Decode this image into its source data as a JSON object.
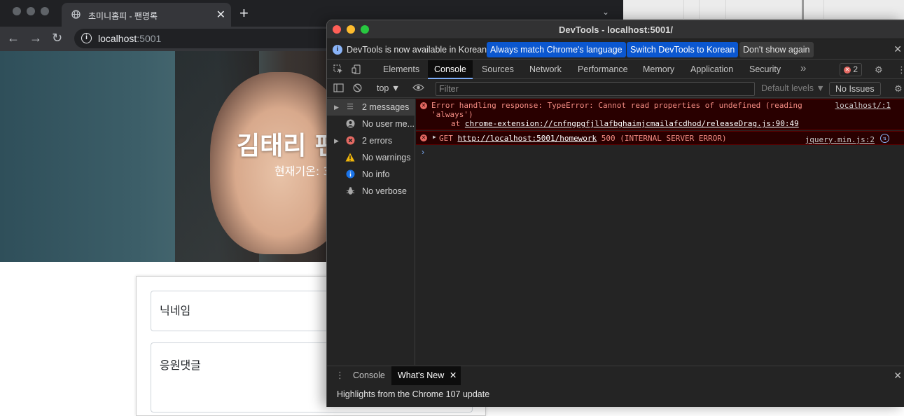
{
  "browser": {
    "tab_title": "초미니홈피 - 팬명록",
    "url_host": "localhost",
    "url_port": ":5001"
  },
  "page": {
    "hero_title": "김태리 팬",
    "weather": "현재기온: 3",
    "nickname_placeholder": "닉네임",
    "comment_placeholder": "응원댓글"
  },
  "devtools": {
    "title": "DevTools - localhost:5001/",
    "infobar": {
      "message": "DevTools is now available in Korean!",
      "btn_match": "Always match Chrome's language",
      "btn_switch": "Switch DevTools to Korean",
      "btn_dismiss": "Don't show again"
    },
    "tabs": [
      "Elements",
      "Console",
      "Sources",
      "Network",
      "Performance",
      "Memory",
      "Application",
      "Security"
    ],
    "more": "»",
    "error_count": "2",
    "toolbar": {
      "context": "top ▼",
      "filter_placeholder": "Filter",
      "levels": "Default levels ▼",
      "issues": "No Issues"
    },
    "sidebar": [
      {
        "label": "2 messages",
        "icon": "list-icon"
      },
      {
        "label": "No user me...",
        "icon": "user-icon"
      },
      {
        "label": "2 errors",
        "icon": "error-icon"
      },
      {
        "label": "No warnings",
        "icon": "warning-icon"
      },
      {
        "label": "No info",
        "icon": "info-icon"
      },
      {
        "label": "No verbose",
        "icon": "bug-icon"
      }
    ],
    "messages": [
      {
        "line1": "Error handling response: TypeError: Cannot read properties of undefined (reading",
        "line2": "'always')",
        "line3_prefix": "at ",
        "line3_link": "chrome-extension://cnfngpgfjllafbghaimjcmailafcdhod/releaseDrag.js:90:49",
        "source": "localhost/:1"
      },
      {
        "prefix": "GET ",
        "link": "http://localhost:5001/homework",
        "suffix": " 500 (INTERNAL SERVER ERROR)",
        "source": "jquery.min.js:2"
      }
    ],
    "drawer": {
      "tabs": [
        "Console",
        "What's New"
      ],
      "highlights": "Highlights from the Chrome 107 update"
    }
  }
}
